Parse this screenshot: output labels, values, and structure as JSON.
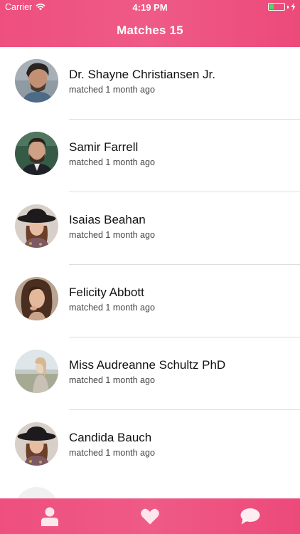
{
  "status_bar": {
    "carrier": "Carrier",
    "time": "4:19 PM",
    "battery_level": 0.35
  },
  "nav": {
    "title": "Matches 15"
  },
  "colors": {
    "accent": "#ef5a86",
    "battery_green": "#4cd964"
  },
  "matches": [
    {
      "name": "Dr. Shayne Christiansen Jr.",
      "subtitle": "matched 1 month ago"
    },
    {
      "name": "Samir Farrell",
      "subtitle": "matched 1 month ago"
    },
    {
      "name": "Isaias Beahan",
      "subtitle": "matched 1 month ago"
    },
    {
      "name": "Felicity Abbott",
      "subtitle": "matched 1 month ago"
    },
    {
      "name": "Miss Audreanne Schultz PhD",
      "subtitle": "matched 1 month ago"
    },
    {
      "name": "Candida Bauch",
      "subtitle": "matched 1 month ago"
    }
  ],
  "tabs": [
    {
      "icon": "person-icon"
    },
    {
      "icon": "heart-icon"
    },
    {
      "icon": "chat-bubble-icon"
    }
  ]
}
